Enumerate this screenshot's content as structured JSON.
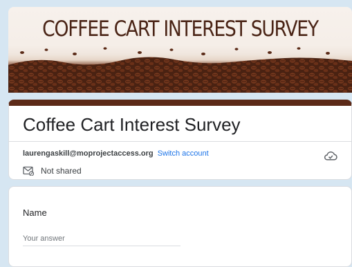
{
  "banner": {
    "title": "COFFEE CART INTEREST SURVEY"
  },
  "form": {
    "title": "Coffee Cart Interest Survey",
    "account_email": "laurengaskill@moprojectaccess.org",
    "switch_account": "Switch account",
    "shared_status": "Not shared"
  },
  "question": {
    "label": "Name",
    "placeholder": "Your answer"
  },
  "colors": {
    "background": "#d6e6f2",
    "accent": "#5c2a18",
    "link": "#1a73e8"
  },
  "icons": [
    "cloud-check-icon",
    "not-shared-mail-icon"
  ]
}
